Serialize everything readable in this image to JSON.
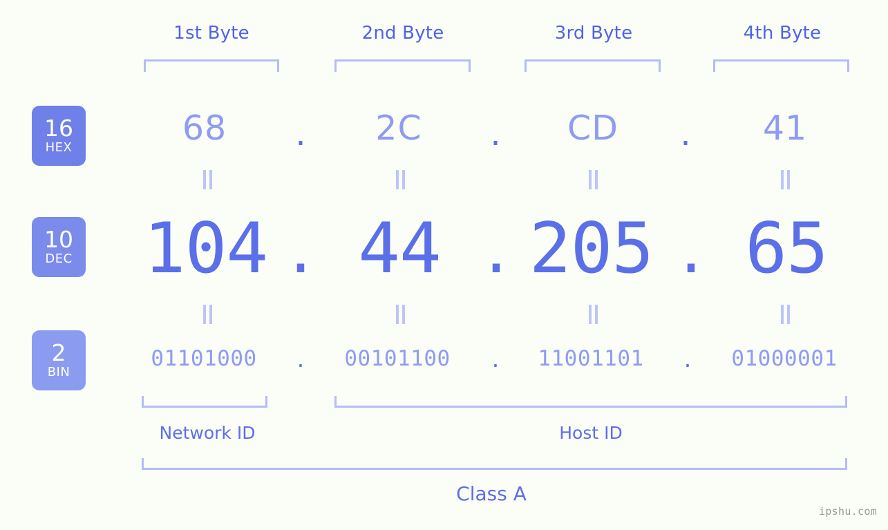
{
  "watermark": "ipshu.com",
  "byte_headers": [
    {
      "label": "1st Byte"
    },
    {
      "label": "2nd Byte"
    },
    {
      "label": "3rd Byte"
    },
    {
      "label": "4th Byte"
    }
  ],
  "rows": [
    {
      "base": "16",
      "base_name": "HEX",
      "values": [
        "68",
        "2C",
        "CD",
        "41"
      ],
      "separator": "."
    },
    {
      "base": "10",
      "base_name": "DEC",
      "values": [
        "104",
        "44",
        "205",
        "65"
      ],
      "separator": "."
    },
    {
      "base": "2",
      "base_name": "BIN",
      "values": [
        "01101000",
        "00101100",
        "11001101",
        "01000001"
      ],
      "separator": "."
    }
  ],
  "sections": [
    {
      "label": "Network ID"
    },
    {
      "label": "Host ID"
    }
  ],
  "class_label": "Class A",
  "colors": {
    "background": "#fbfdf7",
    "accent_dark": "#4f63e8",
    "accent_mid": "#5b6fe8",
    "accent_light": "#8e9cf2",
    "bracket": "#b3bdf6",
    "badge_hex": "#6f80e9",
    "badge_dec": "#7a8bec",
    "badge_bin": "#8b9bf0",
    "watermark": "#9a9a9a"
  }
}
